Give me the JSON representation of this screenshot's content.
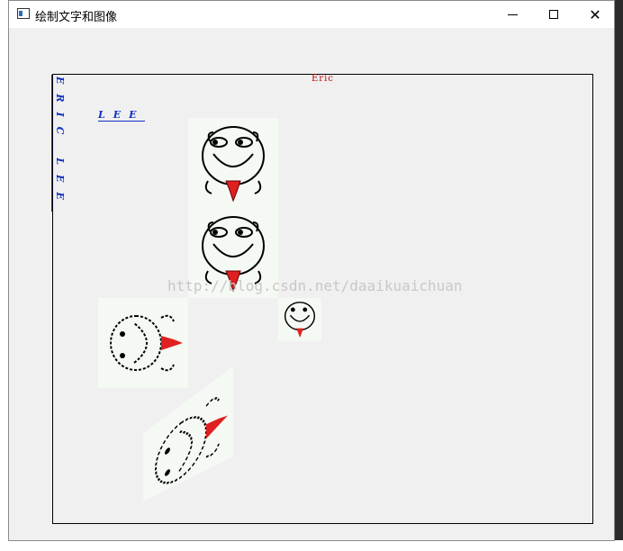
{
  "window": {
    "title": "绘制文字和图像"
  },
  "canvas": {
    "top_label": "Eric",
    "vertical_label": "ERIC LEE",
    "horizontal_label": "LEE",
    "watermark": "http://blog.csdn.net/daaikuaichuan"
  },
  "colors": {
    "red_text": "#c00000",
    "blue_text": "#1030c0",
    "tile_bg": "#f5f9f3",
    "scarf": "#e02020"
  }
}
